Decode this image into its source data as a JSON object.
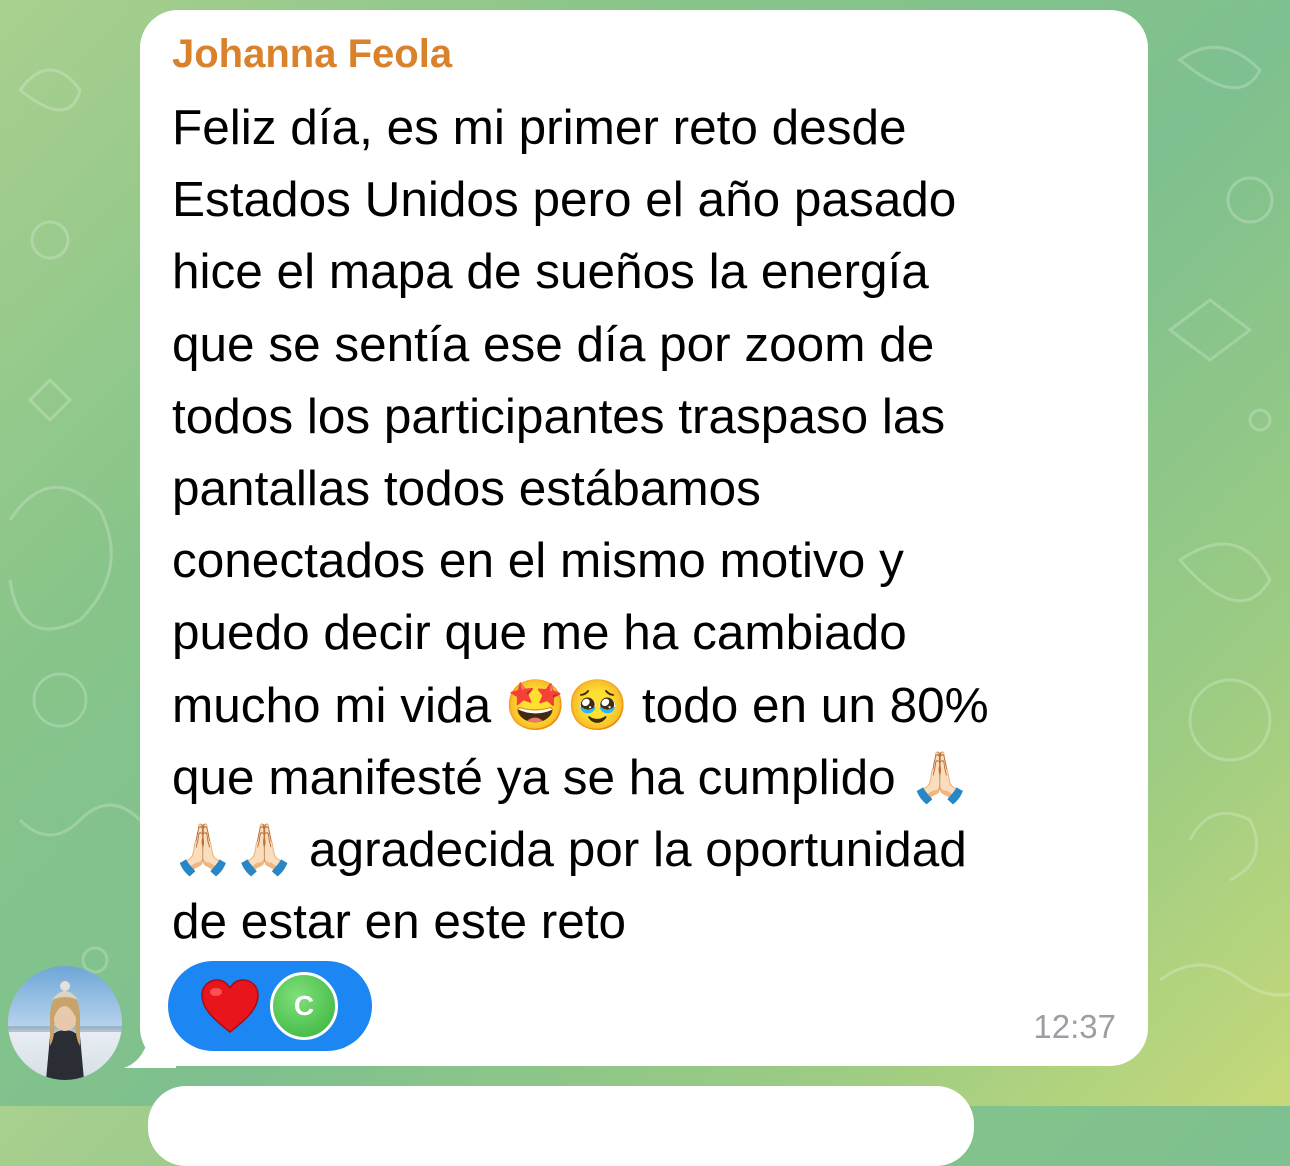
{
  "chat": {
    "sender_name": "Johanna Feola",
    "message_text": "Feliz día, es mi primer reto desde\nEstados Unidos pero el año pasado\nhice el mapa de sueños la energía\nque se sentía ese día por zoom de\ntodos los participantes traspaso las\npantallas todos estábamos\nconectados en el mismo motivo y\npuedo decir que me ha cambiado\nmucho mi vida 🤩🥹 todo en un 80%\nque manifesté ya se ha cumplido 🙏🏻\n🙏🏻🙏🏻 agradecida por la oportunidad\nde estar en este reto",
    "timestamp": "12:37",
    "reaction": {
      "icon": "heart-icon",
      "reactor_initial": "C"
    },
    "avatar_icon": "profile-photo"
  },
  "colors": {
    "sender_name": "#d9822b",
    "reaction_pill": "#1c87f2",
    "reactor_avatar": "#4cbf4e"
  }
}
